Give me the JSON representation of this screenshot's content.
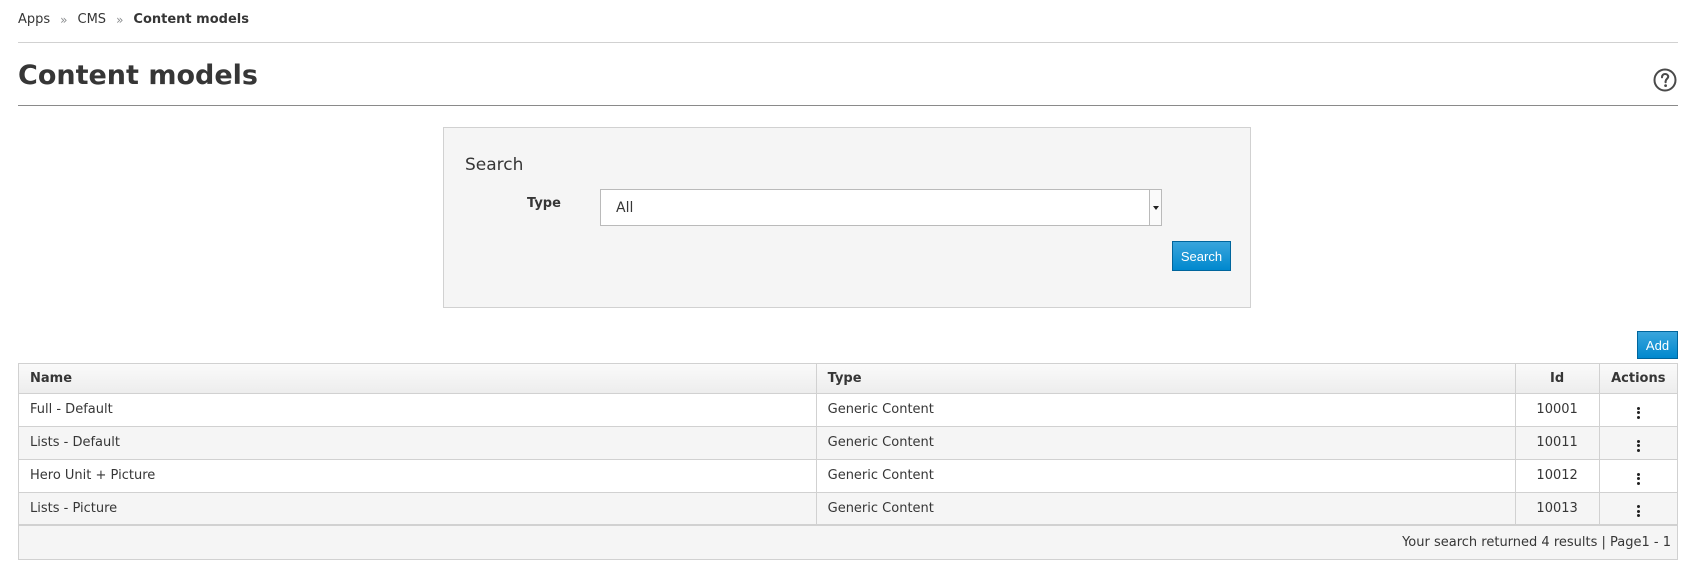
{
  "breadcrumb": {
    "items": [
      "Apps",
      "CMS"
    ],
    "current": "Content models",
    "separator": "»"
  },
  "page": {
    "title": "Content models",
    "help_icon": "question-circle-icon"
  },
  "search": {
    "heading": "Search",
    "type_label": "Type",
    "type_selected": "All",
    "button_label": "Search"
  },
  "toolbar": {
    "add_label": "Add"
  },
  "table": {
    "columns": [
      "Name",
      "Type",
      "Id",
      "Actions"
    ],
    "rows": [
      {
        "name": "Full - Default",
        "type": "Generic Content",
        "id": "10001"
      },
      {
        "name": "Lists - Default",
        "type": "Generic Content",
        "id": "10011"
      },
      {
        "name": "Hero Unit + Picture",
        "type": "Generic Content",
        "id": "10012"
      },
      {
        "name": "Lists - Picture",
        "type": "Generic Content",
        "id": "10013"
      }
    ],
    "footer": "Your search returned 4 results | Page1 - 1"
  },
  "colors": {
    "primary": "#0088ce",
    "primary_border": "#00659c",
    "panel_bg": "#f5f5f5",
    "border": "#d1d1d1"
  }
}
